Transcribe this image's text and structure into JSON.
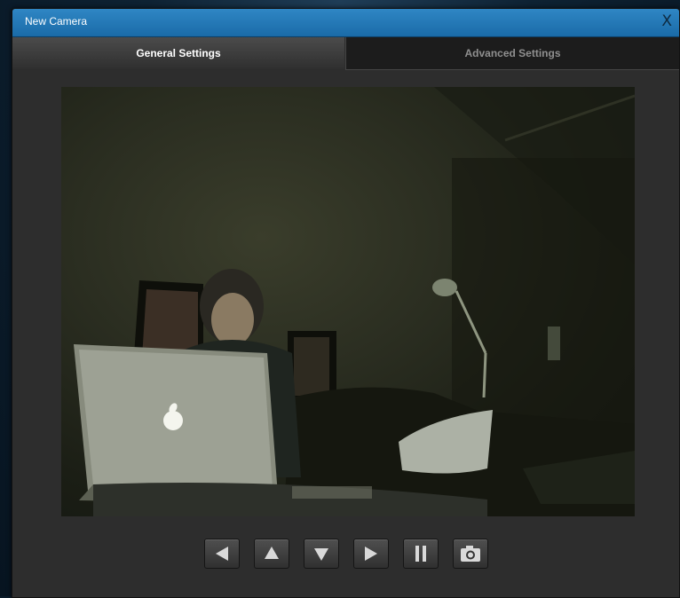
{
  "dialog": {
    "title": "New Camera",
    "close_label": "X"
  },
  "tabs": [
    {
      "label": "General Settings",
      "active": true
    },
    {
      "label": "Advanced Settings",
      "active": false
    }
  ],
  "camera": {
    "feed": "live-camera-feed"
  },
  "controls": [
    {
      "icon": "arrow-left-icon"
    },
    {
      "icon": "arrow-up-icon"
    },
    {
      "icon": "arrow-down-icon"
    },
    {
      "icon": "arrow-right-icon"
    },
    {
      "icon": "pause-icon"
    },
    {
      "icon": "camera-icon"
    }
  ],
  "colors": {
    "titlebar": "#2f86c4",
    "dialog_bg": "#2d2d2d",
    "icon": "#d9d9d9"
  }
}
